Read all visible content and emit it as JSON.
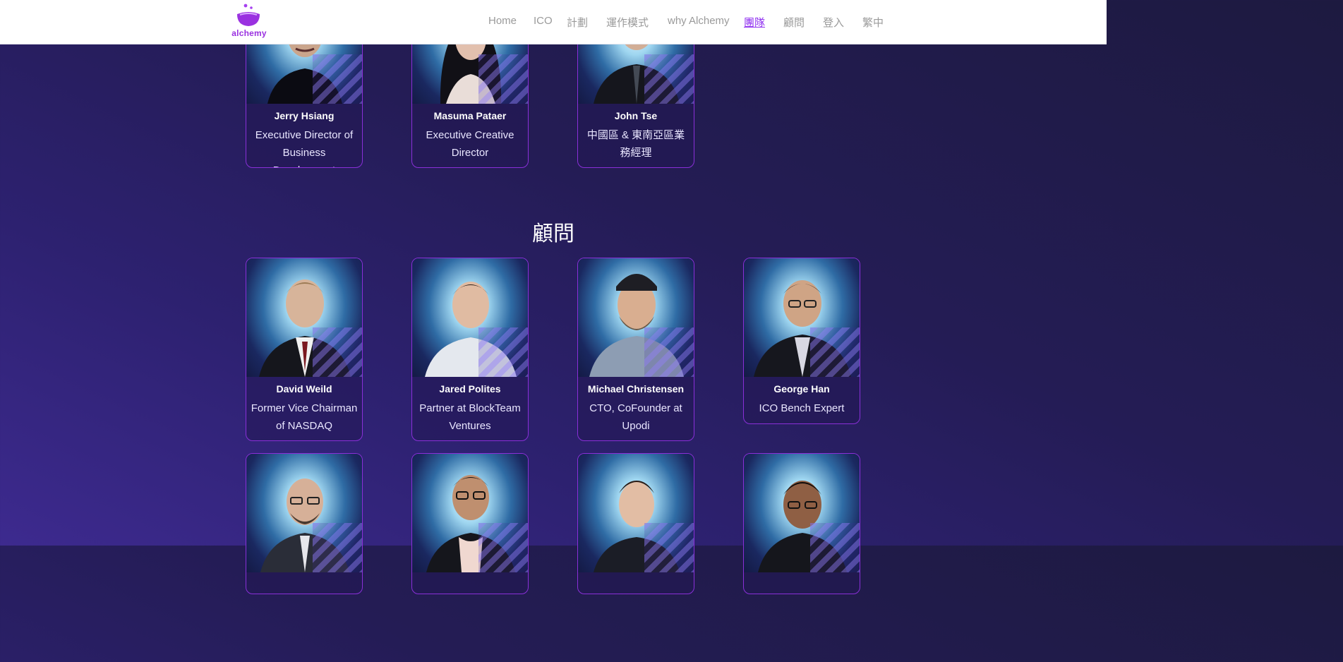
{
  "nav": {
    "logo_text": "alchemy",
    "items": [
      {
        "label": "Home"
      },
      {
        "label": "ICO"
      },
      {
        "label": "計劃"
      },
      {
        "label": "運作模式"
      },
      {
        "label": "why Alchemy"
      },
      {
        "label": "團隊",
        "active": true
      },
      {
        "label": "顧問"
      },
      {
        "label": "登入"
      },
      {
        "label": "繁中"
      }
    ]
  },
  "team": [
    {
      "name": "Jerry Hsiang",
      "role": "Executive Director of Business Development"
    },
    {
      "name": "Masuma Pataer",
      "role": "Executive Creative Director"
    },
    {
      "name": "John Tse",
      "role": "中國區 & 東南亞區業務經理"
    }
  ],
  "advisors": {
    "title": "顧問",
    "members": [
      {
        "name": "David Weild",
        "role": "Former Vice Chairman of NASDAQ"
      },
      {
        "name": "Jared Polites",
        "role": "Partner at BlockTeam Ventures"
      },
      {
        "name": "Michael Christensen",
        "role": "CTO, CoFounder at Upodi"
      },
      {
        "name": "George Han",
        "role": "ICO Bench Expert"
      }
    ]
  },
  "colors": {
    "accent": "#8f2ff0",
    "card_border": "#8a2fd8",
    "background_dark": "#1d1a40",
    "background_purple": "#3d2a8f"
  }
}
